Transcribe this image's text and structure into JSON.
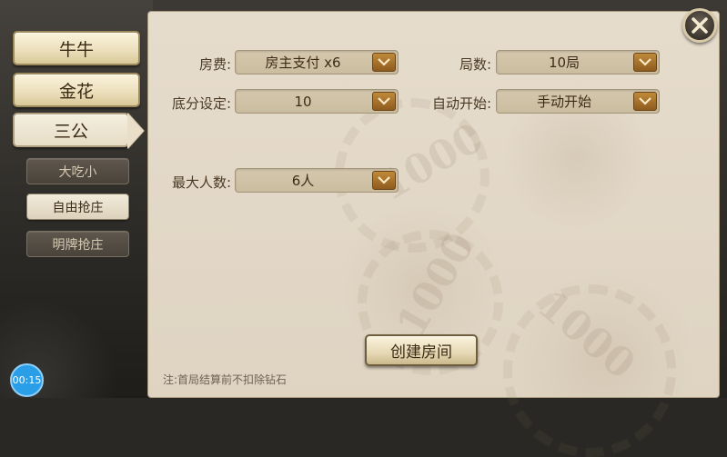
{
  "categories": [
    {
      "label": "牛牛"
    },
    {
      "label": "金花"
    },
    {
      "label": "三公"
    }
  ],
  "modes": [
    {
      "label": "大吃小"
    },
    {
      "label": "自由抢庄"
    },
    {
      "label": "明牌抢庄"
    }
  ],
  "form": {
    "fee": {
      "label": "房费:",
      "value": "房主支付 x6"
    },
    "rounds": {
      "label": "局数:",
      "value": "10局"
    },
    "base_score": {
      "label": "底分设定:",
      "value": "10"
    },
    "auto_start": {
      "label": "自动开始:",
      "value": "手动开始"
    },
    "max_players": {
      "label": "最大人数:",
      "value": "6人"
    }
  },
  "create_button": "创建房间",
  "note": "注:首局结算前不扣除钻石",
  "timer": "00:15",
  "decor": {
    "chip_value": "1000"
  },
  "colors": {
    "accent_dropdown": "#a8702c",
    "timer_blue": "#2a9ee6",
    "panel_bg": "#e3d8c6"
  }
}
